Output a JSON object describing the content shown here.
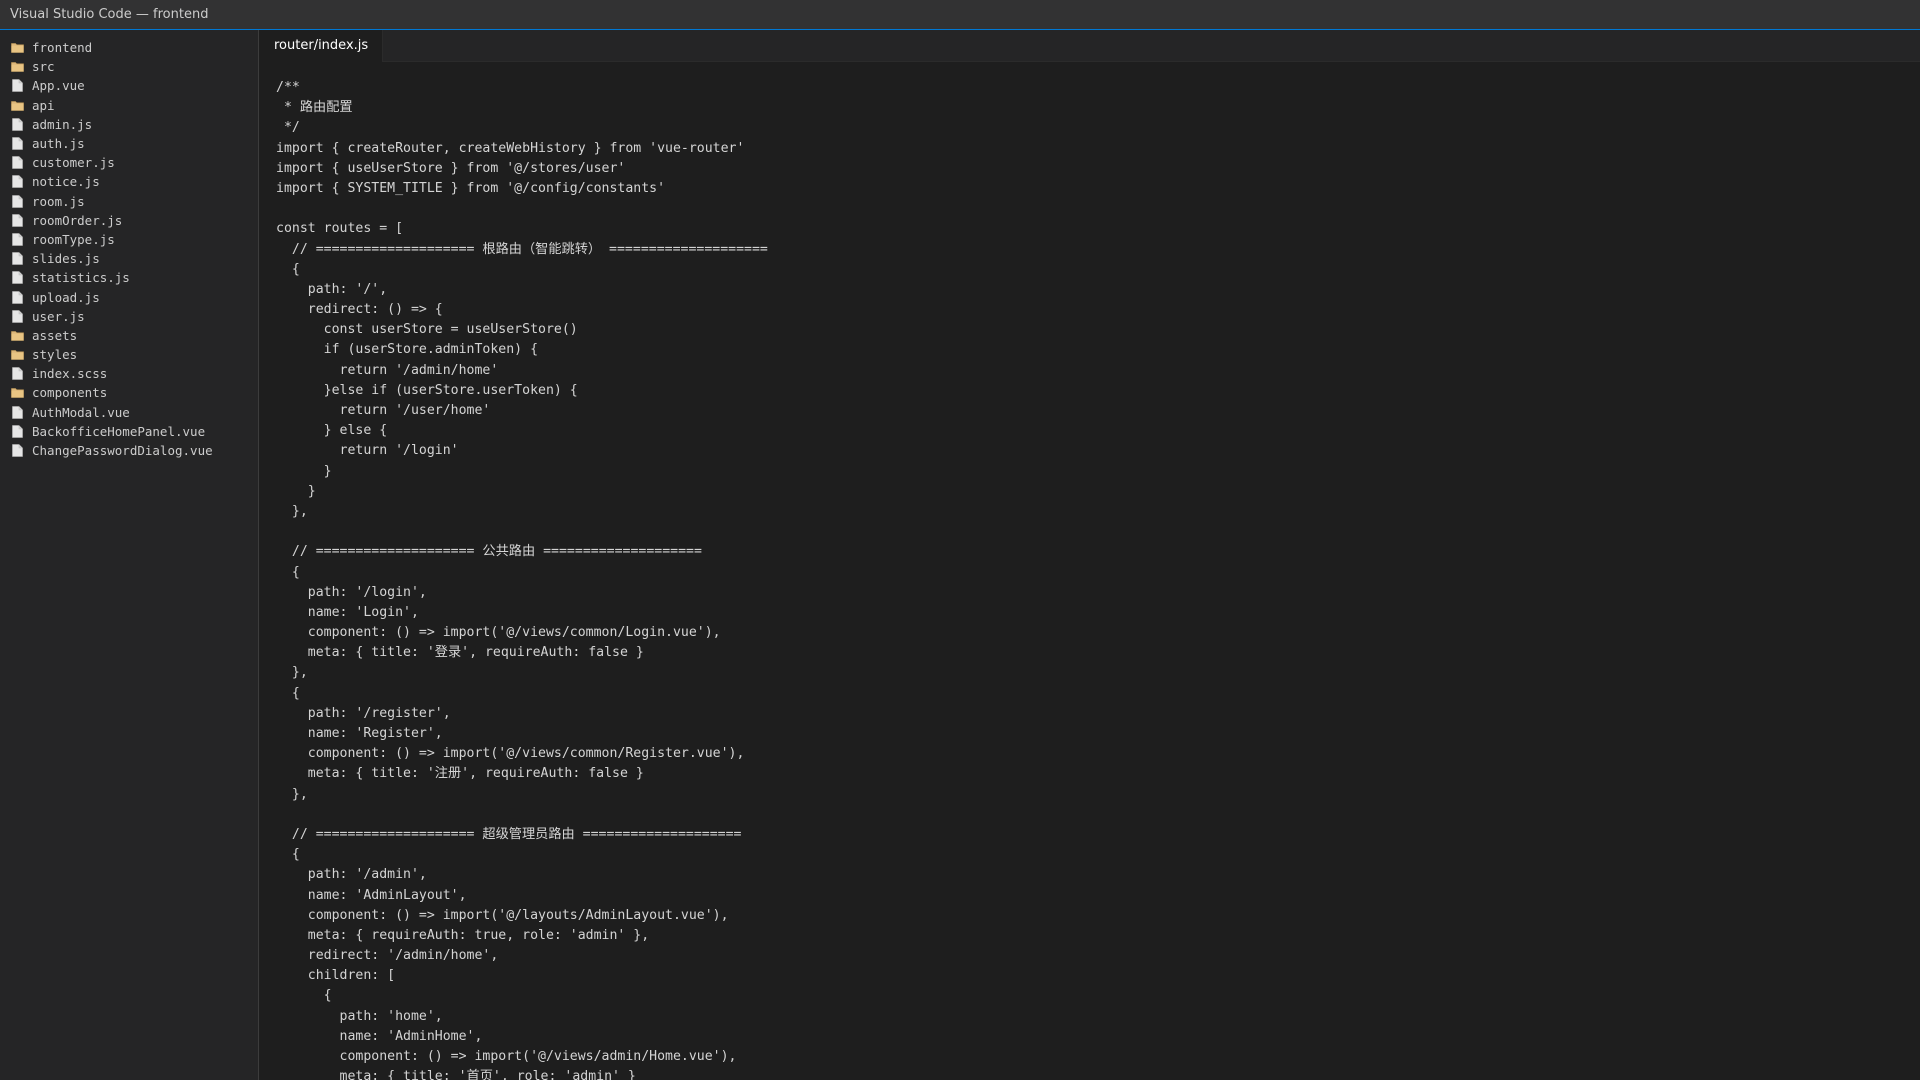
{
  "window": {
    "title": "Visual Studio Code — frontend"
  },
  "sidebar": {
    "items": [
      {
        "label": "frontend",
        "icon": "folder-icon"
      },
      {
        "label": "src",
        "icon": "folder-icon"
      },
      {
        "label": "App.vue",
        "icon": "file-icon"
      },
      {
        "label": "api",
        "icon": "folder-icon"
      },
      {
        "label": "admin.js",
        "icon": "file-icon"
      },
      {
        "label": "auth.js",
        "icon": "file-icon"
      },
      {
        "label": "customer.js",
        "icon": "file-icon"
      },
      {
        "label": "notice.js",
        "icon": "file-icon"
      },
      {
        "label": "room.js",
        "icon": "file-icon"
      },
      {
        "label": "roomOrder.js",
        "icon": "file-icon"
      },
      {
        "label": "roomType.js",
        "icon": "file-icon"
      },
      {
        "label": "slides.js",
        "icon": "file-icon"
      },
      {
        "label": "statistics.js",
        "icon": "file-icon"
      },
      {
        "label": "upload.js",
        "icon": "file-icon"
      },
      {
        "label": "user.js",
        "icon": "file-icon"
      },
      {
        "label": "assets",
        "icon": "folder-icon"
      },
      {
        "label": "styles",
        "icon": "folder-icon"
      },
      {
        "label": "index.scss",
        "icon": "file-icon"
      },
      {
        "label": "components",
        "icon": "folder-icon"
      },
      {
        "label": "AuthModal.vue",
        "icon": "file-icon"
      },
      {
        "label": "BackofficeHomePanel.vue",
        "icon": "file-icon"
      },
      {
        "label": "ChangePasswordDialog.vue",
        "icon": "file-icon"
      }
    ]
  },
  "editor": {
    "tab_label": "router/index.js",
    "lines": [
      "/**",
      " * 路由配置",
      " */",
      "import { createRouter, createWebHistory } from 'vue-router'",
      "import { useUserStore } from '@/stores/user'",
      "import { SYSTEM_TITLE } from '@/config/constants'",
      "",
      "const routes = [",
      "  // ==================== 根路由（智能跳转） ====================",
      "  {",
      "    path: '/',",
      "    redirect: () => {",
      "      const userStore = useUserStore()",
      "      if (userStore.adminToken) {",
      "        return '/admin/home'",
      "      }else if (userStore.userToken) {",
      "        return '/user/home'",
      "      } else {",
      "        return '/login'",
      "      }",
      "    }",
      "  },",
      "",
      "  // ==================== 公共路由 ====================",
      "  {",
      "    path: '/login',",
      "    name: 'Login',",
      "    component: () => import('@/views/common/Login.vue'),",
      "    meta: { title: '登录', requireAuth: false }",
      "  },",
      "  {",
      "    path: '/register',",
      "    name: 'Register',",
      "    component: () => import('@/views/common/Register.vue'),",
      "    meta: { title: '注册', requireAuth: false }",
      "  },",
      "",
      "  // ==================== 超级管理员路由 ====================",
      "  {",
      "    path: '/admin',",
      "    name: 'AdminLayout',",
      "    component: () => import('@/layouts/AdminLayout.vue'),",
      "    meta: { requireAuth: true, role: 'admin' },",
      "    redirect: '/admin/home',",
      "    children: [",
      "      {",
      "        path: 'home',",
      "        name: 'AdminHome',",
      "        component: () => import('@/views/admin/Home.vue'),",
      "        meta: { title: '首页', role: 'admin' }"
    ]
  }
}
